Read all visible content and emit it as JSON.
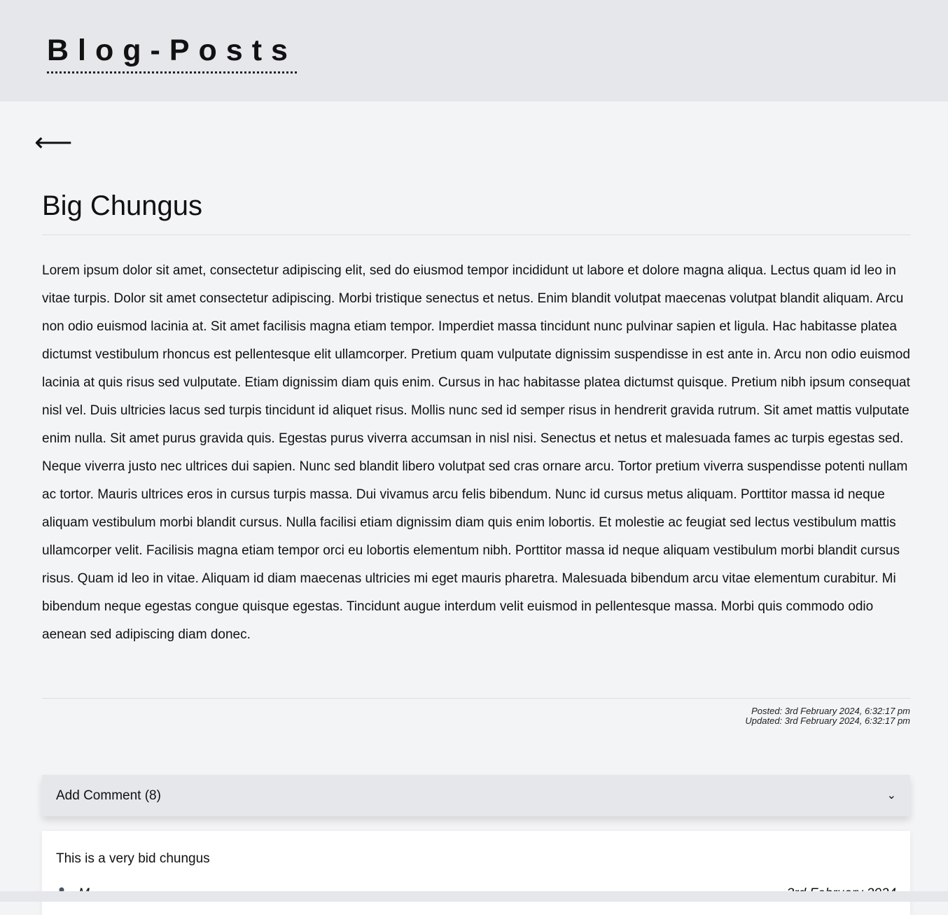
{
  "header": {
    "logo_text": "Blog-Posts"
  },
  "nav": {
    "back_icon": "left-arrow-icon",
    "back_glyph": "⟵"
  },
  "post": {
    "title": "Big Chungus",
    "body": "Lorem ipsum dolor sit amet, consectetur adipiscing elit, sed do eiusmod tempor incididunt ut labore et dolore magna aliqua. Lectus quam id leo in vitae turpis. Dolor sit amet consectetur adipiscing. Morbi tristique senectus et netus. Enim blandit volutpat maecenas volutpat blandit aliquam. Arcu non odio euismod lacinia at. Sit amet facilisis magna etiam tempor. Imperdiet massa tincidunt nunc pulvinar sapien et ligula. Hac habitasse platea dictumst vestibulum rhoncus est pellentesque elit ullamcorper. Pretium quam vulputate dignissim suspendisse in est ante in. Arcu non odio euismod lacinia at quis risus sed vulputate. Etiam dignissim diam quis enim. Cursus in hac habitasse platea dictumst quisque. Pretium nibh ipsum consequat nisl vel. Duis ultricies lacus sed turpis tincidunt id aliquet risus. Mollis nunc sed id semper risus in hendrerit gravida rutrum. Sit amet mattis vulputate enim nulla. Sit amet purus gravida quis. Egestas purus viverra accumsan in nisl nisi. Senectus et netus et malesuada fames ac turpis egestas sed. Neque viverra justo nec ultrices dui sapien. Nunc sed blandit libero volutpat sed cras ornare arcu. Tortor pretium viverra suspendisse potenti nullam ac tortor. Mauris ultrices eros in cursus turpis massa. Dui vivamus arcu felis bibendum. Nunc id cursus metus aliquam. Porttitor massa id neque aliquam vestibulum morbi blandit cursus. Nulla facilisi etiam dignissim diam quis enim lobortis. Et molestie ac feugiat sed lectus vestibulum mattis ullamcorper velit. Facilisis magna etiam tempor orci eu lobortis elementum nibh. Porttitor massa id neque aliquam vestibulum morbi blandit cursus risus. Quam id leo in vitae. Aliquam id diam maecenas ultricies mi eget mauris pharetra. Malesuada bibendum arcu vitae elementum curabitur. Mi bibendum neque egestas congue quisque egestas. Tincidunt augue interdum velit euismod in pellentesque massa. Morbi quis commodo odio aenean sed adipiscing diam donec.",
    "posted": "Posted: 3rd February 2024, 6:32:17 pm",
    "updated": "Updated: 3rd February 2024, 6:32:17 pm"
  },
  "comments": {
    "toggle_label": "Add Comment (8)",
    "toggle_icon": "chevron-down-icon",
    "toggle_glyph": "⌄",
    "items": [
      {
        "text": "This is a very bid chungus",
        "author": "M",
        "author_icon": "user-icon",
        "date": "3rd February 2024"
      }
    ]
  },
  "colors": {
    "page_background": "#f3f4f6",
    "header_background": "#e5e7eb",
    "card_background": "#ffffff",
    "text": "#111111"
  }
}
